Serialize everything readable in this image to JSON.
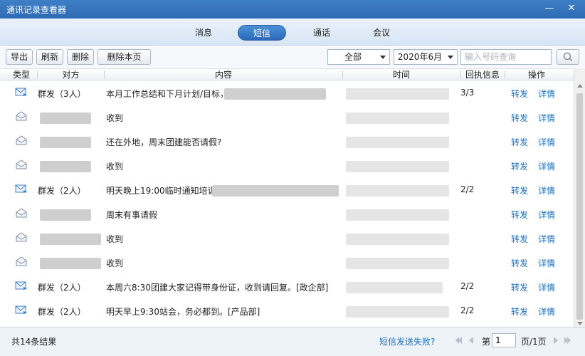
{
  "window": {
    "title": "通讯记录查看器",
    "minimize_glyph": "—",
    "close_glyph": "✕"
  },
  "tabs": [
    {
      "label": "消息",
      "active": false
    },
    {
      "label": "短信",
      "active": true
    },
    {
      "label": "通话",
      "active": false
    },
    {
      "label": "会议",
      "active": false
    }
  ],
  "toolbar": {
    "export_label": "导出",
    "refresh_label": "刷新",
    "delete_label": "删除",
    "delete_page_label": "删除本页",
    "filter_value": "全部",
    "month_value": "2020年6月",
    "search_placeholder": "输入号码查询"
  },
  "columns": [
    "类型",
    "对方",
    "内容",
    "时间",
    "回执信息",
    "操作"
  ],
  "rows": [
    {
      "type_icon": "sent-mail-icon",
      "party": "群发（3人）",
      "content": "本月工作总结和下月计划/目标，",
      "receipt": "3/3",
      "forward": "转发",
      "detail": "详情"
    },
    {
      "type_icon": "received-mail-icon",
      "party": "",
      "content": "收到",
      "receipt": "",
      "forward": "转发",
      "detail": "详情"
    },
    {
      "type_icon": "received-mail-icon",
      "party": "",
      "content": "还在外地，周末团建能否请假?",
      "receipt": "",
      "forward": "转发",
      "detail": "详情"
    },
    {
      "type_icon": "received-mail-icon",
      "party": "",
      "content": "收到",
      "receipt": "",
      "forward": "转发",
      "detail": "详情"
    },
    {
      "type_icon": "sent-mail-icon",
      "party": "群发（2人）",
      "content": "明天晚上19:00临时通知培训",
      "receipt": "2/2",
      "forward": "转发",
      "detail": "详情"
    },
    {
      "type_icon": "received-mail-icon",
      "party": "",
      "content": "周末有事请假",
      "receipt": "",
      "forward": "转发",
      "detail": "详情"
    },
    {
      "type_icon": "received-mail-icon",
      "party": "",
      "content": "收到",
      "receipt": "",
      "forward": "转发",
      "detail": "详情"
    },
    {
      "type_icon": "received-mail-icon",
      "party": "",
      "content": "收到",
      "receipt": "",
      "forward": "转发",
      "detail": "详情"
    },
    {
      "type_icon": "sent-mail-icon",
      "party": "群发（2人）",
      "content": "本周六8:30团建大家记得带身份证，收到请回复。[政企部]",
      "receipt": "2/2",
      "forward": "转发",
      "detail": "详情"
    },
    {
      "type_icon": "sent-mail-icon",
      "party": "群发（2人）",
      "content": "明天早上9:30站会，务必都到。[产品部]",
      "receipt": "2/2",
      "forward": "转发",
      "detail": "详情"
    }
  ],
  "footer": {
    "result_count": "共14条结果",
    "failed_link": "短信发送失败?",
    "page_prefix": "第",
    "page_value": "1",
    "page_suffix": "页/1页"
  },
  "colors": {
    "title_bar": "#2d6bb4",
    "active_tab": "#2a69b8",
    "link": "#1a6fc2"
  }
}
